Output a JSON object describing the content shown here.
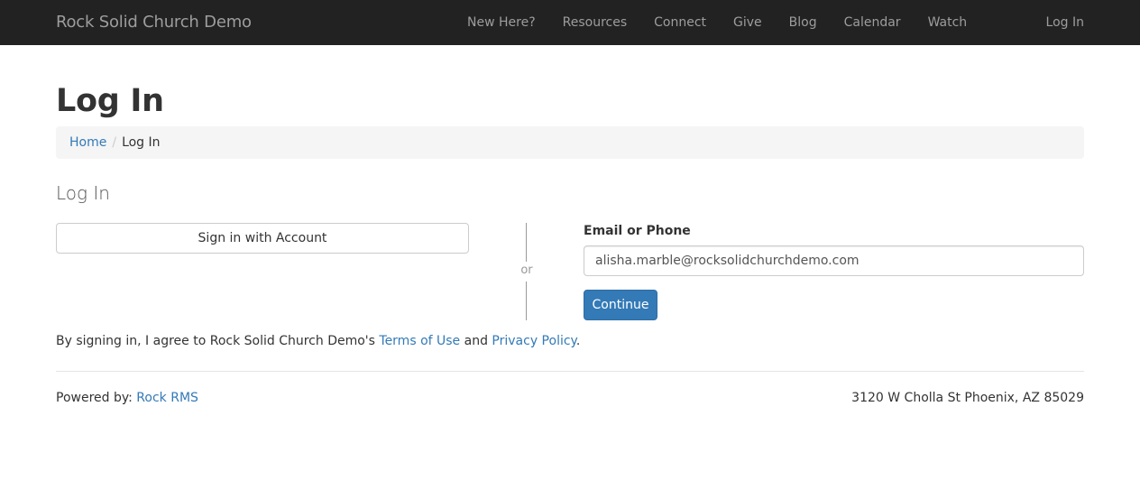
{
  "navbar": {
    "brand": "Rock Solid Church Demo",
    "items": [
      {
        "label": "New Here?"
      },
      {
        "label": "Resources"
      },
      {
        "label": "Connect"
      },
      {
        "label": "Give"
      },
      {
        "label": "Blog"
      },
      {
        "label": "Calendar"
      },
      {
        "label": "Watch"
      }
    ],
    "login": "Log In"
  },
  "page": {
    "title": "Log In"
  },
  "breadcrumb": {
    "home": "Home",
    "separator": "/",
    "current": "Log In"
  },
  "login_panel": {
    "title": "Log In",
    "account_button": "Sign in with Account",
    "or_text": "or",
    "email_label": "Email or Phone",
    "email_value": "alisha.marble@rocksolidchurchdemo.com",
    "continue_button": "Continue"
  },
  "agreement": {
    "prefix": "By signing in, I agree to Rock Solid Church Demo's ",
    "terms": "Terms of Use",
    "and": " and ",
    "privacy": "Privacy Policy",
    "suffix": "."
  },
  "footer": {
    "powered_prefix": "Powered by: ",
    "powered_link": "Rock RMS",
    "address": "3120 W Cholla St Phoenix, AZ 85029"
  },
  "colors": {
    "navbar_bg": "#222222",
    "nav_text": "#9d9d9d",
    "link": "#337ab7",
    "primary_button": "#337ab7"
  }
}
